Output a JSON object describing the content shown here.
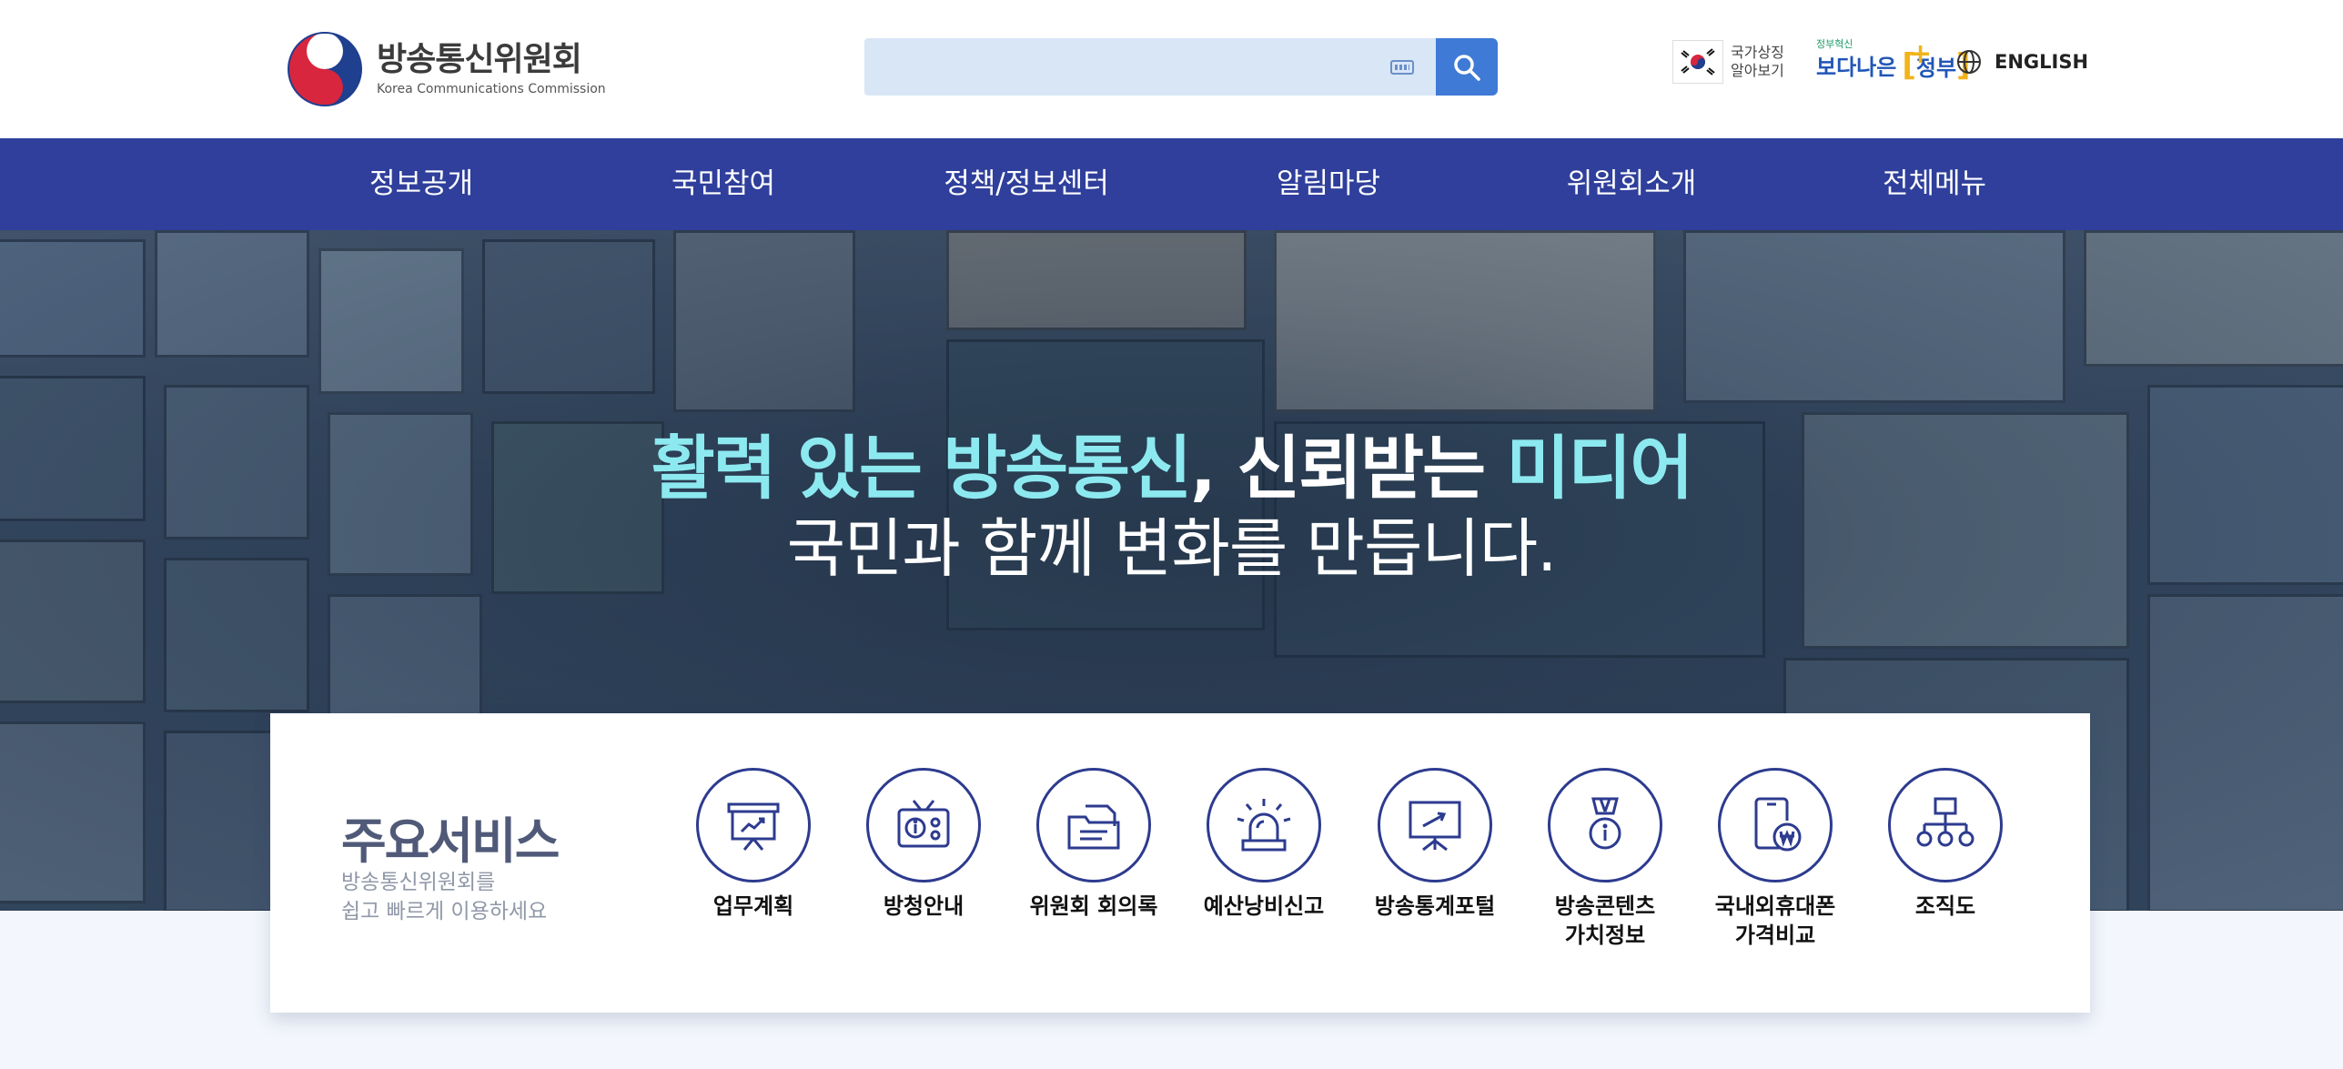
{
  "header": {
    "logo_ko": "방송통신위원회",
    "logo_en": "Korea Communications Commission",
    "search": {
      "placeholder": "",
      "value": ""
    },
    "symbol_text_1": "국가상징",
    "symbol_text_2": "알아보기",
    "gov_small": "정부혁신",
    "gov_big_1": "보다나은",
    "gov_big_2": "정부",
    "english": "ENGLISH"
  },
  "nav": {
    "items": [
      "정보공개",
      "국민참여",
      "정책/정보센터",
      "알림마당",
      "위원회소개",
      "전체메뉴"
    ]
  },
  "hero": {
    "line1_a": "활력 있는 ",
    "line1_b": "방송통신",
    "line1_c": ", 신뢰받는 ",
    "line1_d": "미디어",
    "line2": "국민과 함께 변화를 만듭니다."
  },
  "services": {
    "title": "주요서비스",
    "desc_1": "방송통신위원회를",
    "desc_2": "쉽고 빠르게 이용하세요",
    "items": [
      {
        "label": "업무계획",
        "icon": "presentation-chart-icon"
      },
      {
        "label": "방청안내",
        "icon": "radio-info-icon"
      },
      {
        "label": "위원회 회의록",
        "icon": "folder-document-icon"
      },
      {
        "label": "예산낭비신고",
        "icon": "siren-icon"
      },
      {
        "label": "방송통계포털",
        "icon": "easel-chart-icon"
      },
      {
        "label_1": "방송콘텐츠",
        "label_2": "가치정보",
        "icon": "medal-info-icon"
      },
      {
        "label_1": "국내외휴대폰",
        "label_2": "가격비교",
        "icon": "phone-won-icon"
      },
      {
        "label": "조직도",
        "icon": "org-chart-icon"
      }
    ]
  },
  "colors": {
    "nav_bg": "#2f3f9b",
    "accent": "#3e7ad6",
    "hero_highlight": "#8de9f0",
    "icon_stroke": "#2d3b8f"
  }
}
